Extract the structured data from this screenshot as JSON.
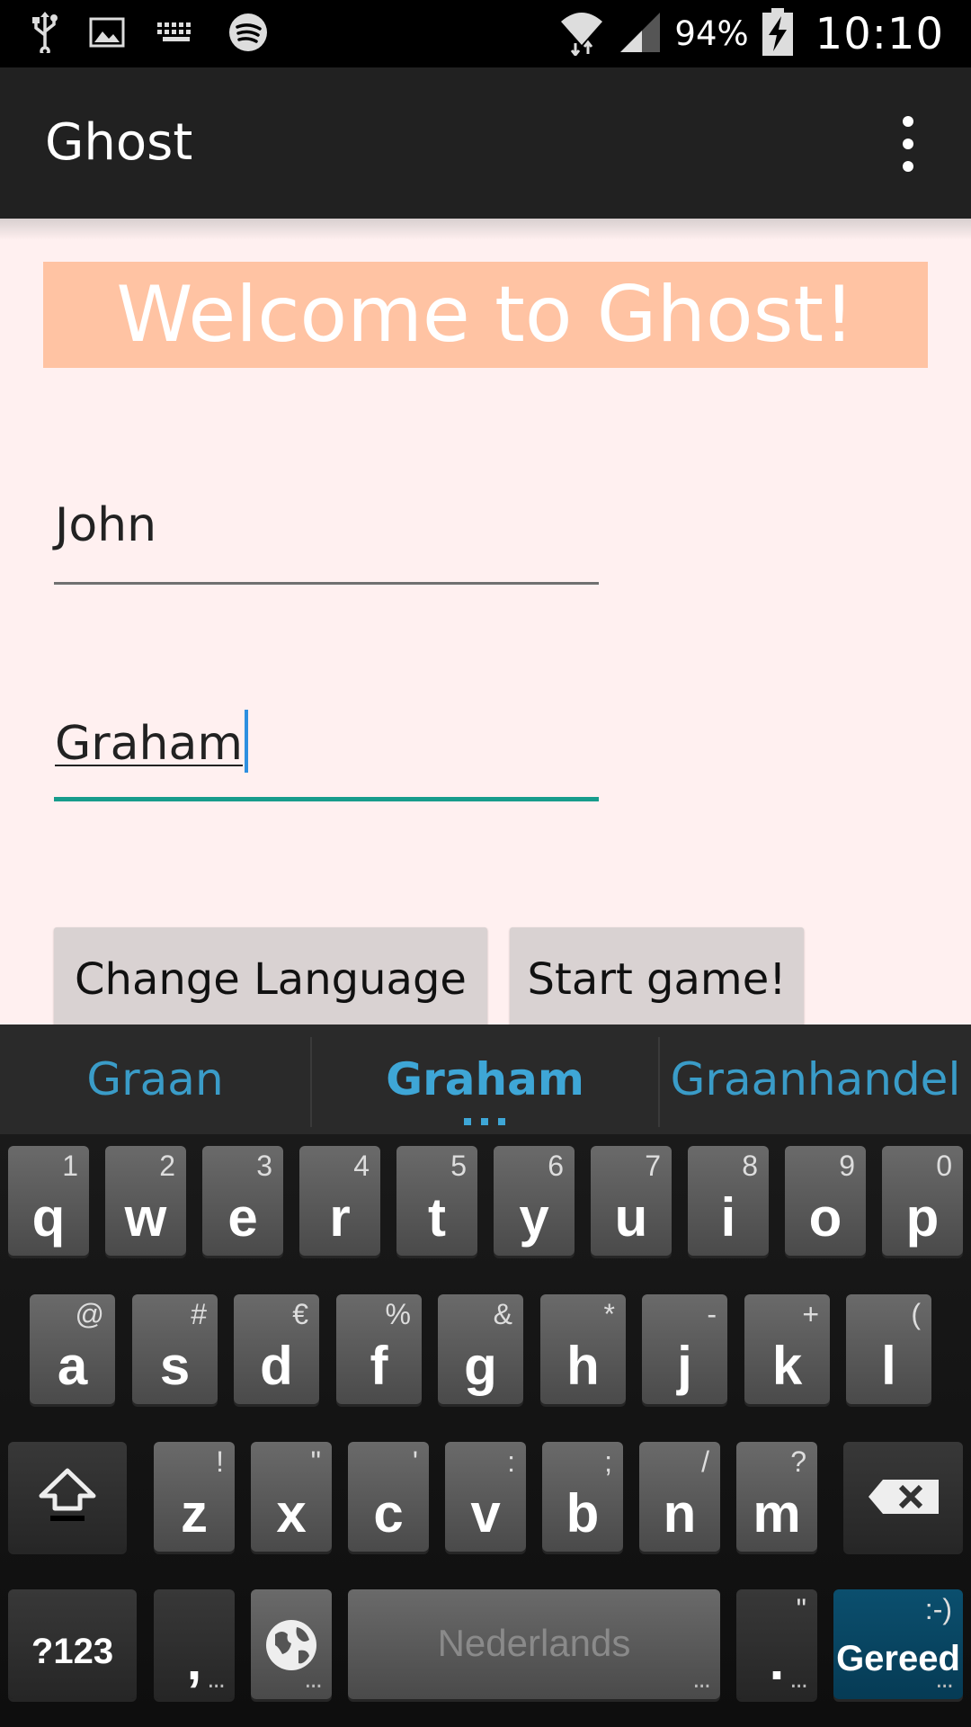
{
  "status_bar": {
    "battery_percent": "94%",
    "time": "10:10",
    "left_icons": [
      "usb-icon",
      "image-icon",
      "keyboard-icon",
      "spotify-icon"
    ],
    "right_icons": [
      "wifi-icon",
      "signal-icon",
      "battery-charging-icon"
    ]
  },
  "app_bar": {
    "title": "Ghost",
    "overflow_icon": "overflow-menu-icon"
  },
  "main": {
    "welcome": "Welcome to Ghost!",
    "player1_value": "John",
    "player2_value": "Graham",
    "change_language_label": "Change Language",
    "start_game_label": "Start game!"
  },
  "keyboard": {
    "suggestions": [
      "Graan",
      "Graham",
      "Graanhandel"
    ],
    "row1": [
      {
        "key": "q",
        "hint": "1"
      },
      {
        "key": "w",
        "hint": "2"
      },
      {
        "key": "e",
        "hint": "3"
      },
      {
        "key": "r",
        "hint": "4"
      },
      {
        "key": "t",
        "hint": "5"
      },
      {
        "key": "y",
        "hint": "6"
      },
      {
        "key": "u",
        "hint": "7"
      },
      {
        "key": "i",
        "hint": "8"
      },
      {
        "key": "o",
        "hint": "9"
      },
      {
        "key": "p",
        "hint": "0"
      }
    ],
    "row2": [
      {
        "key": "a",
        "hint": "@"
      },
      {
        "key": "s",
        "hint": "#"
      },
      {
        "key": "d",
        "hint": "€"
      },
      {
        "key": "f",
        "hint": "%"
      },
      {
        "key": "g",
        "hint": "&"
      },
      {
        "key": "h",
        "hint": "*"
      },
      {
        "key": "j",
        "hint": "-"
      },
      {
        "key": "k",
        "hint": "+"
      },
      {
        "key": "l",
        "hint": "("
      }
    ],
    "row3": [
      {
        "key": "z",
        "hint": "!"
      },
      {
        "key": "x",
        "hint": "\""
      },
      {
        "key": "c",
        "hint": "'"
      },
      {
        "key": "v",
        "hint": ":"
      },
      {
        "key": "b",
        "hint": ";"
      },
      {
        "key": "n",
        "hint": "/"
      },
      {
        "key": "m",
        "hint": "?"
      }
    ],
    "symbols_label": "?123",
    "comma_label": ",",
    "space_label": "Nederlands",
    "period_label": ".",
    "period_hint": "\"",
    "done_label": "Gereed",
    "done_hint": ":-)",
    "colors": {
      "accent": "#3ea6d6",
      "done_key": "#0b4f6e"
    }
  },
  "colors": {
    "app_bar": "#212121",
    "content_bg": "#fff0f0",
    "banner": "#ffc3a3",
    "focused_underline": "#179c8c",
    "button_bg": "#d9d2d2"
  }
}
